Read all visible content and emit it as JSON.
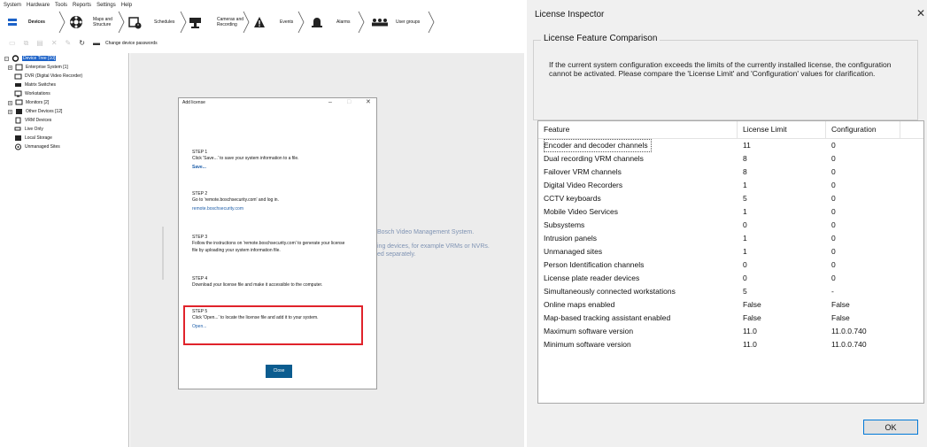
{
  "app": {
    "menu": [
      "System",
      "Hardware",
      "Tools",
      "Reports",
      "Settings",
      "Help"
    ],
    "workflow": {
      "devices": "Devices",
      "maps_line1": "Maps and",
      "maps_line2": "Structure",
      "schedules": "Schedules",
      "cameras_line1": "Cameras and",
      "cameras_line2": "Recording",
      "events": "Events",
      "alarms": "Alarms",
      "user_groups": "User groups"
    },
    "toolbar": {
      "change_passwords": "Change device passwords"
    },
    "tree": {
      "root": "Device Tree [10]",
      "items": [
        "Enterprise System [1]",
        "DVR (Digital Video Recorder)",
        "Matrix Switches",
        "Workstations",
        "Monitors [2]",
        "Other Devices [12]",
        "VRM Devices",
        "Live Only",
        "Local Storage",
        "Unmanaged Sites"
      ]
    },
    "background_text": {
      "line1": "Bosch Video Management System.",
      "line2": "ing devices, for example VRMs or NVRs.",
      "line3": "ed separately."
    },
    "dialog": {
      "title": "Add license",
      "step1": {
        "heading": "STEP 1",
        "text": "Click 'Save...' to save your system information to a file.",
        "link": "Save..."
      },
      "step2": {
        "heading": "STEP 2",
        "text": "Go to 'remote.boschsecurity.com' and log in.",
        "link": "remote.boschsecurity.com"
      },
      "step3": {
        "heading": "STEP 3",
        "text1": "Follow the instructions on 'remote.boschsecurity.com' to generate your license",
        "text2": "file by uploading your system information file."
      },
      "step4": {
        "heading": "STEP 4",
        "text": "Download your license file and make it accessible to the computer."
      },
      "step5": {
        "heading": "STEP 5",
        "text": "Click 'Open...' to locate the license file and add it to your system.",
        "link": "Open..."
      },
      "close": "Close"
    }
  },
  "inspector": {
    "title": "License Inspector",
    "group_label": "License Feature Comparison",
    "description": "If the current system configuration exceeds the limits of the currently installed license, the configuration cannot be activated. Please compare the 'License Limit' and 'Configuration' values for clarification.",
    "columns": [
      "Feature",
      "License Limit",
      "Configuration"
    ],
    "rows": [
      [
        "Encoder and decoder channels",
        "11",
        "0"
      ],
      [
        "Dual recording VRM channels",
        "8",
        "0"
      ],
      [
        "Failover VRM channels",
        "8",
        "0"
      ],
      [
        "Digital Video Recorders",
        "1",
        "0"
      ],
      [
        "CCTV keyboards",
        "5",
        "0"
      ],
      [
        "Mobile Video Services",
        "1",
        "0"
      ],
      [
        "Subsystems",
        "0",
        "0"
      ],
      [
        "Intrusion panels",
        "1",
        "0"
      ],
      [
        "Unmanaged sites",
        "1",
        "0"
      ],
      [
        "Person Identification channels",
        "0",
        "0"
      ],
      [
        "License plate reader devices",
        "0",
        "0"
      ],
      [
        "Simultaneously connected workstations",
        "5",
        "-"
      ],
      [
        "Online maps enabled",
        "False",
        "False"
      ],
      [
        "Map-based tracking assistant enabled",
        "False",
        "False"
      ],
      [
        "Maximum software version",
        "11.0",
        "11.0.0.740"
      ],
      [
        "Minimum software version",
        "11.0",
        "11.0.0.740"
      ]
    ],
    "ok": "OK"
  }
}
